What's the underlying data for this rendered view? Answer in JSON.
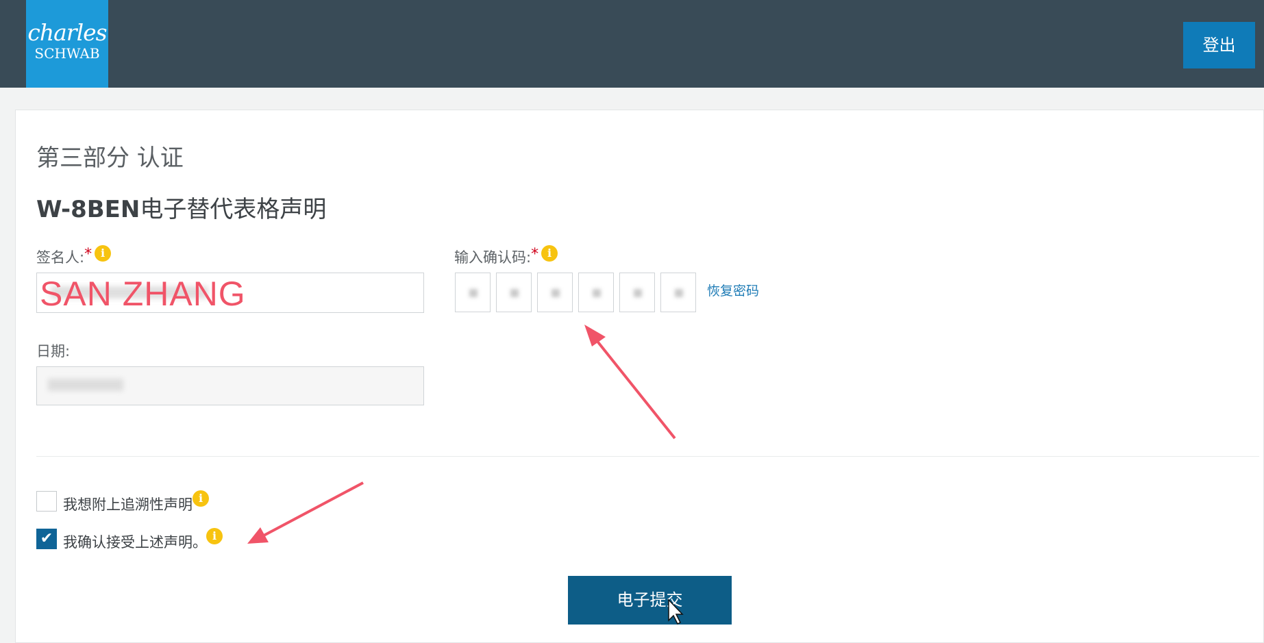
{
  "header": {
    "logo_line1": "charles",
    "logo_line2": "SCHWAB",
    "logout_label": "登出"
  },
  "page": {
    "section_title": "第三部分 认证",
    "form_title_bold": "W-8BEN",
    "form_title_rest": "电子替代表格声明"
  },
  "fields": {
    "signer_label": "签名人:",
    "signer_value": "SAN ZHANG",
    "code_label": "输入确认码:",
    "recover_link": "恢复密码",
    "date_label": "日期:",
    "required_mark": "*",
    "info_glyph": "i"
  },
  "checkboxes": {
    "retroactive_label": "我想附上追溯性声明",
    "retroactive_checked": false,
    "accept_label": "我确认接受上述声明。",
    "accept_checked": true,
    "check_glyph": "✔"
  },
  "actions": {
    "submit_label": "电子提交"
  },
  "colors": {
    "topbar": "#394b57",
    "logo_bg": "#1d9ad9",
    "accent": "#0d5d87",
    "annotation": "#f05468",
    "info": "#f7c310"
  }
}
